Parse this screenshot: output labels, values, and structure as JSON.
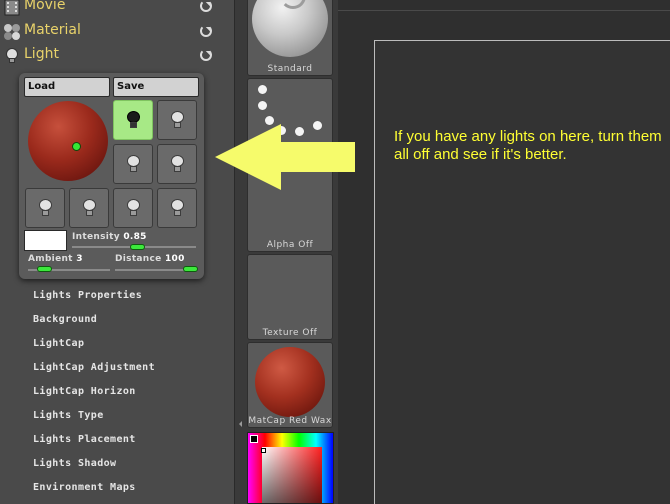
{
  "palette": {
    "headers": [
      {
        "name": "movie",
        "label": "Movie",
        "icon": "film-icon"
      },
      {
        "name": "material",
        "label": "Material",
        "icon": "material-spheres-icon"
      },
      {
        "name": "light",
        "label": "Light",
        "icon": "lightbulb-icon"
      }
    ]
  },
  "light": {
    "load_label": "Load",
    "save_label": "Save",
    "intensity_label": "Intensity",
    "intensity_value": "0.85",
    "ambient_label": "Ambient",
    "ambient_value": "3",
    "distance_label": "Distance",
    "distance_value": "100",
    "swatch_color": "#ffffff",
    "active_light_index": 0,
    "light_count": 8
  },
  "menu": [
    "Lights Properties",
    "Background",
    "LightCap",
    "LightCap Adjustment",
    "LightCap Horizon",
    "Lights Type",
    "Lights Placement",
    "Lights Shadow",
    "Environment Maps"
  ],
  "thumbnails": {
    "material_label": "Standard",
    "alpha_label": "Alpha  Off",
    "texture_label": "Texture  Off",
    "matcap_label": "MatCap  Red  Wax"
  },
  "annotation": {
    "text": "If you have any lights on here, turn them all off and see if it's better.",
    "color": "#ffff33",
    "arrow_color": "#f6fb6b"
  }
}
